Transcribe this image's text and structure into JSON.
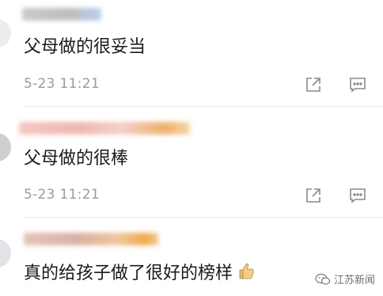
{
  "comments": [
    {
      "text": "父母做的很妥当",
      "time": "5-23 11:21",
      "share_icon": "share-icon",
      "reply_icon": "comment-icon"
    },
    {
      "text": "父母做的很棒",
      "time": "5-23 11:21",
      "share_icon": "share-icon",
      "reply_icon": "comment-icon"
    },
    {
      "text": "真的给孩子做了很好的榜样",
      "emoji": "thumbs-up-icon"
    }
  ],
  "watermark": {
    "label": "江苏新闻",
    "icon": "wechat-icon"
  },
  "colors": {
    "text": "#1a1a1a",
    "meta": "#9b9b9b",
    "icon": "#8a8a8a"
  }
}
